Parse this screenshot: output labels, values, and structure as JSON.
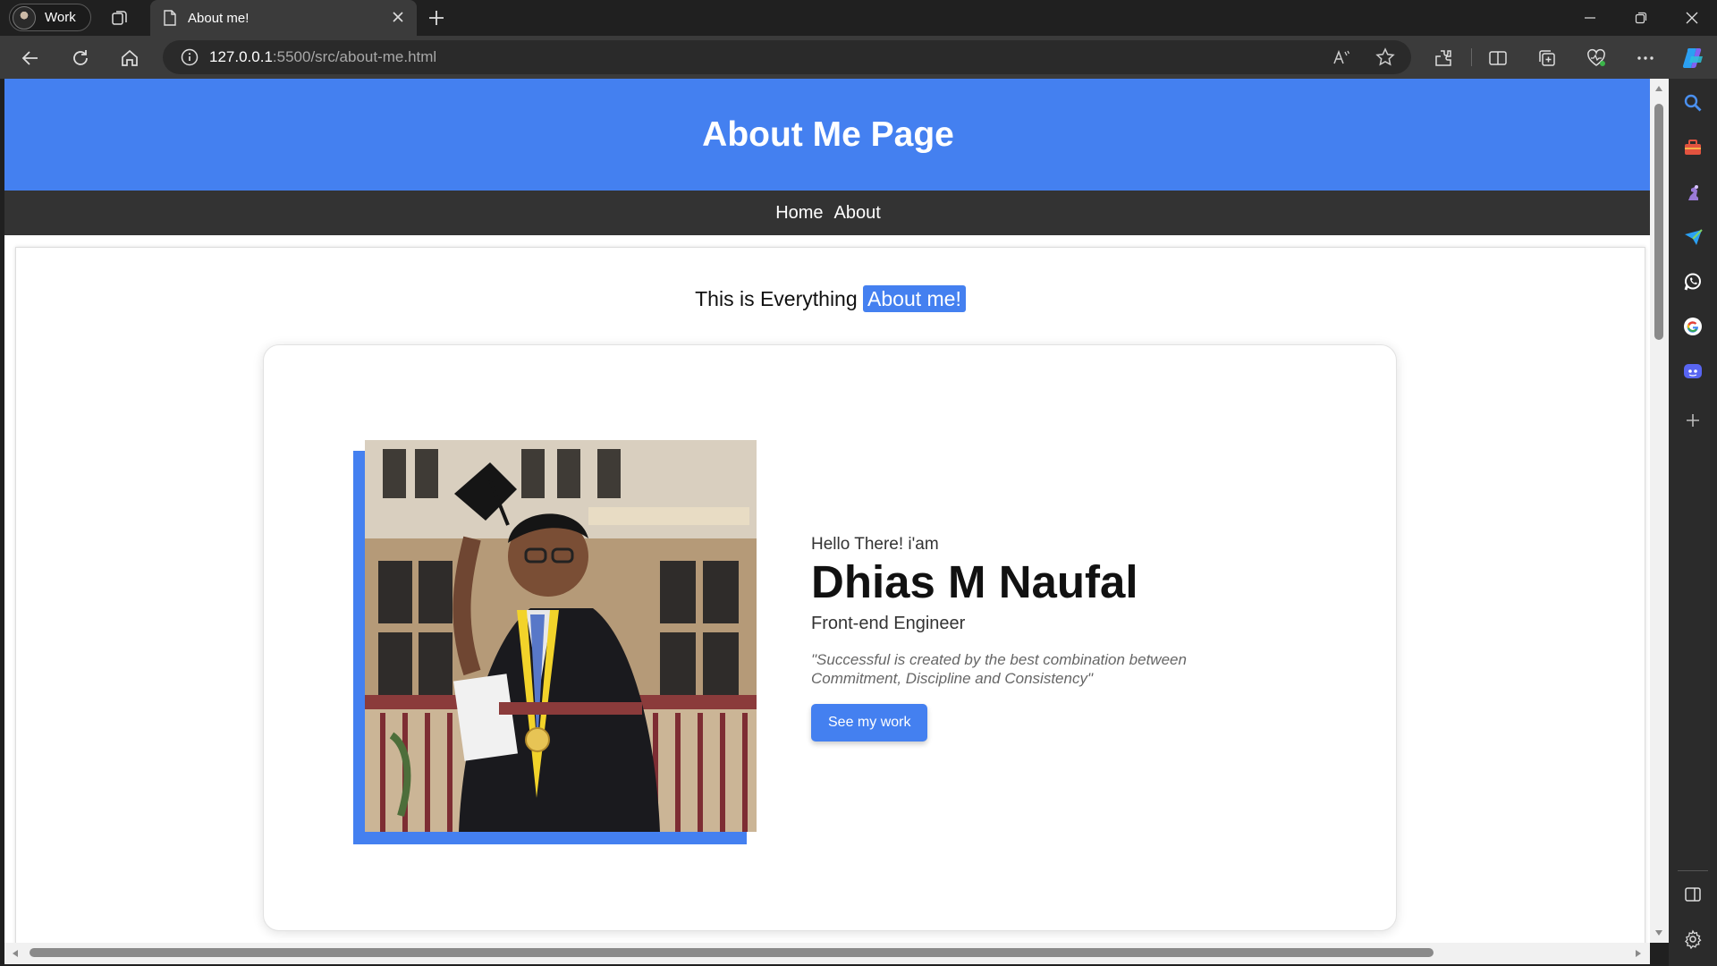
{
  "browser": {
    "profile_label": "Work",
    "tab_title": "About me!",
    "url_host": "127.0.0.1",
    "url_rest": ":5500/src/about-me.html"
  },
  "page": {
    "title": "About Me Page",
    "nav": [
      "Home",
      "About"
    ],
    "headline_prefix": "This is Everything",
    "headline_highlight": "About me!",
    "greeting": "Hello There! i'am",
    "name": "Dhias M Naufal",
    "role": "Front-end Engineer",
    "quote": "\"Successful is created by the best combination between Commitment, Discipline and Consistency\"",
    "cta_label": "See my work"
  },
  "colors": {
    "accent": "#4480f0",
    "nav_bg": "#333333"
  },
  "icons": [
    "workspaces-icon",
    "page-icon",
    "close-icon",
    "new-tab-icon",
    "back-icon",
    "refresh-icon",
    "home-icon",
    "site-info-icon",
    "read-aloud-icon",
    "favorite-icon",
    "extensions-icon",
    "split-screen-icon",
    "collections-icon",
    "browser-essentials-icon",
    "more-icon",
    "copilot-icon",
    "search-icon",
    "tools-icon",
    "games-icon",
    "send-icon",
    "whatsapp-icon",
    "google-icon",
    "discord-icon",
    "add-icon",
    "sidebar-toggle-icon",
    "settings-icon"
  ]
}
